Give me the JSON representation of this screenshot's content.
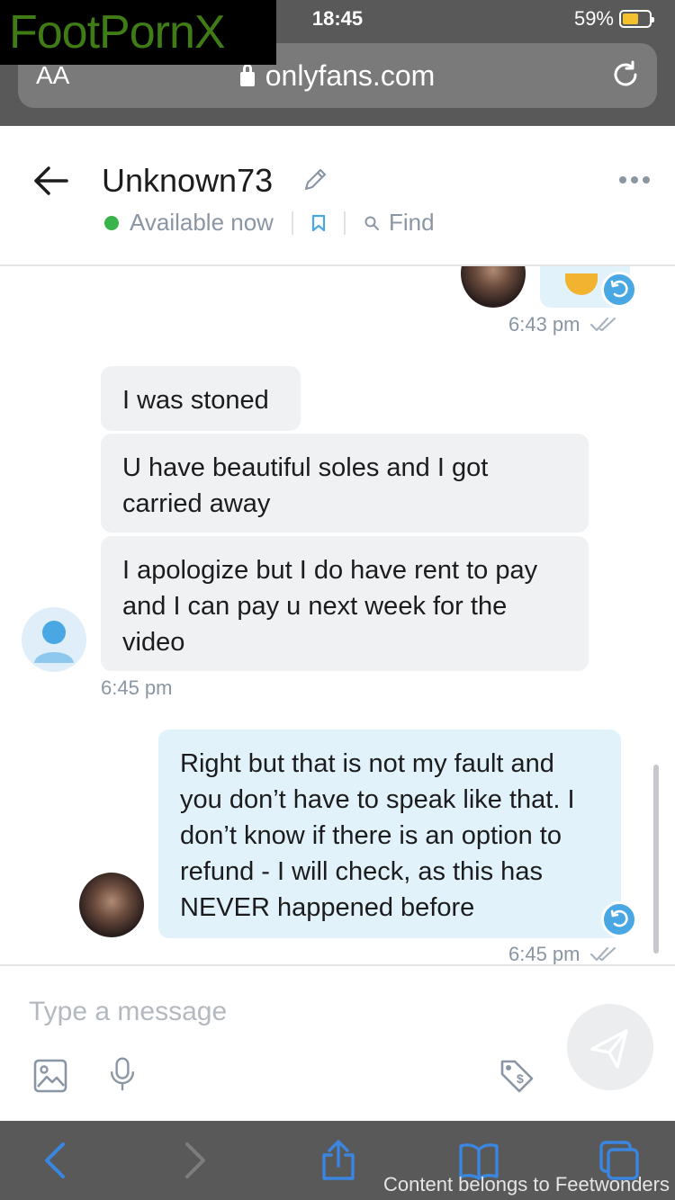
{
  "status_bar": {
    "time": "18:45",
    "battery": "59%",
    "battery_level": 0.59
  },
  "watermark": {
    "text": "FootPornX"
  },
  "safari": {
    "text_size_label": "AA",
    "url": "onlyfans.com"
  },
  "chat_header": {
    "username": "Unknown73",
    "status": "Available now",
    "find_label": "Find"
  },
  "messages": [
    {
      "from": "me",
      "time": "6:43 pm"
    },
    {
      "from": "them",
      "lines": [
        "I was stoned",
        "U have beautiful soles and I got carried away",
        "I apologize but I do have rent to pay and I can pay u next week for the video"
      ],
      "time": "6:45 pm"
    },
    {
      "from": "me",
      "text": "Right but that is not my fault and you don’t have to speak like that. I don’t know if there is an option to refund - I will check, as this has NEVER happened before",
      "time": "6:45 pm"
    }
  ],
  "composer": {
    "placeholder": "Type a message"
  },
  "footer": {
    "credit": "Content belongs to Feetwonders"
  },
  "colors": {
    "accent": "#49a8e3",
    "online": "#37b34a",
    "out_bubble": "#e2f2fb",
    "in_bubble": "#f0f1f3"
  }
}
